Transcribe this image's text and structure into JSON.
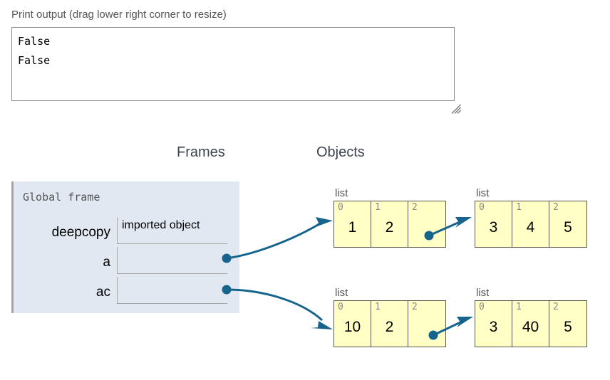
{
  "print_output": {
    "label": "Print output (drag lower right corner to resize)",
    "text": "False\nFalse",
    "resize_grip_icon": "resize-grip-icon"
  },
  "headings": {
    "frames": "Frames",
    "objects": "Objects"
  },
  "frame": {
    "title": "Global frame",
    "variables": [
      {
        "name": "deepcopy",
        "value": "imported object",
        "is_pointer": false
      },
      {
        "name": "a",
        "value": "",
        "is_pointer": true
      },
      {
        "name": "ac",
        "value": "",
        "is_pointer": true
      }
    ]
  },
  "objects": [
    {
      "id": "obj-a-outer",
      "type_label": "list",
      "cells": [
        {
          "index": "0",
          "value": "1"
        },
        {
          "index": "1",
          "value": "2"
        },
        {
          "index": "2",
          "value": "",
          "is_pointer": true
        }
      ]
    },
    {
      "id": "obj-a-inner",
      "type_label": "list",
      "cells": [
        {
          "index": "0",
          "value": "3"
        },
        {
          "index": "1",
          "value": "4"
        },
        {
          "index": "2",
          "value": "5"
        }
      ]
    },
    {
      "id": "obj-ac-outer",
      "type_label": "list",
      "cells": [
        {
          "index": "0",
          "value": "10"
        },
        {
          "index": "1",
          "value": "2"
        },
        {
          "index": "2",
          "value": "",
          "is_pointer": true
        }
      ]
    },
    {
      "id": "obj-ac-inner",
      "type_label": "list",
      "cells": [
        {
          "index": "0",
          "value": "3"
        },
        {
          "index": "1",
          "value": "40"
        },
        {
          "index": "2",
          "value": "5"
        }
      ]
    }
  ],
  "colors": {
    "frame_background": "#e2e8f2",
    "object_background": "#ffffc6",
    "connector": "#16648c",
    "label_text": "#555555",
    "heading_text": "#3d4450"
  }
}
